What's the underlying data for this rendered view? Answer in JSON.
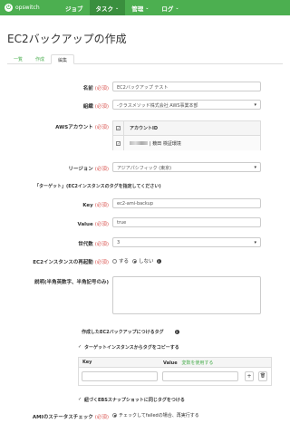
{
  "nav": {
    "logo_text": "opswitch",
    "items": [
      {
        "label": "ジョブ"
      },
      {
        "label": "タスク",
        "caret": "⌄"
      },
      {
        "label": "管理",
        "caret": "⌄"
      },
      {
        "label": "ログ",
        "caret": "⌄"
      }
    ],
    "brand_color": "#4caf50"
  },
  "page_title": "EC2バックアップの作成",
  "tabs": [
    "一覧",
    "作成",
    "編集"
  ],
  "required_mark": "(必須)",
  "form": {
    "name": {
      "label": "名前",
      "value": "EC2バックアップ テスト"
    },
    "org": {
      "label": "組織",
      "value": "-クラスメソッド株式会社 AWS事業本部"
    },
    "aws_account": {
      "label": "AWSアカウント",
      "header": "アカウントID",
      "row_text": "| 薮田 検証環境"
    },
    "region": {
      "label": "リージョン",
      "value": "アジアパシフィック (東京)"
    },
    "target_note": "「ターゲット」(EC2インスタンスのタグを指定してください)",
    "key": {
      "label": "Key",
      "value": "ec2-ami-backup"
    },
    "value": {
      "label": "Value",
      "value": "true"
    },
    "generations": {
      "label": "世代数",
      "value": "3"
    },
    "reboot": {
      "label": "EC2インスタンスの再起動",
      "yes": "する",
      "no": "しない"
    },
    "description": {
      "label": "説明(半角英数字、半角記号のみ)"
    },
    "tags": {
      "title": "作成したEC2バックアップにつけるタグ",
      "copy_label": "ターゲットインスタンスからタグをコピーする",
      "col_key": "Key",
      "col_value": "Value",
      "variable_link": "変数を使用する",
      "add": "+",
      "remove": "🗑"
    },
    "ebs_label": "紐づくEBSスナップショットに同じタグをつける",
    "ami_status": {
      "label": "AMIのステータスチェック",
      "option": "チェックしてfailedの場合、再実行する"
    }
  }
}
